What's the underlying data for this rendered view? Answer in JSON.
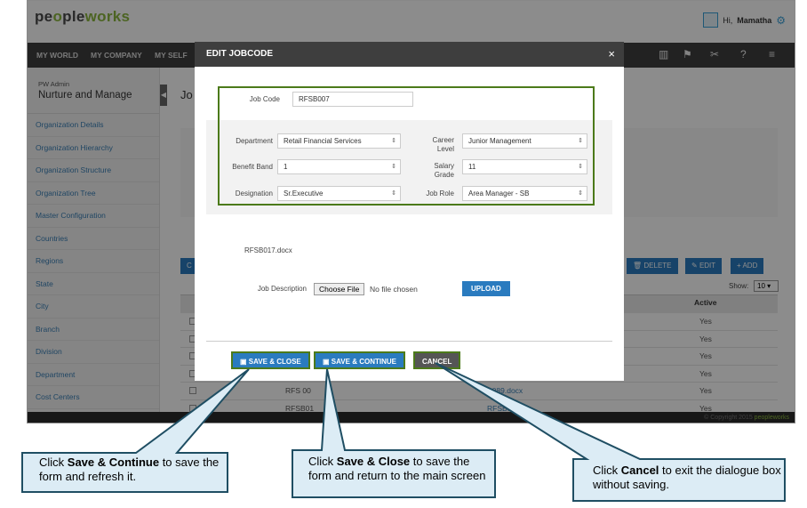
{
  "app": {
    "logo_a": "pe",
    "logo_b": "o",
    "logo_c": "ple",
    "logo_d": "works",
    "greeting": "Hi,",
    "user_name": "Mamatha"
  },
  "nav": {
    "items": [
      "MY WORLD",
      "MY COMPANY",
      "MY SELF"
    ],
    "icons": [
      "book-icon",
      "flag-icon",
      "tools-icon",
      "help-icon",
      "menu-icon"
    ]
  },
  "sidebar": {
    "subtitle": "PW Admin",
    "title": "Nurture and Manage",
    "items": [
      "Organization Details",
      "Organization Hierarchy",
      "Organization Structure",
      "Organization Tree",
      "Master Configuration",
      "Countries",
      "Regions",
      "State",
      "City",
      "Branch",
      "Division",
      "Department",
      "Cost Centers"
    ]
  },
  "main": {
    "title_partial": "Jo",
    "btn_c": "C",
    "delete_label": "DELETE",
    "edit_label": "EDIT",
    "add_label": "ADD",
    "show_label": "Show:",
    "show_value": "10",
    "col_active": "Active",
    "rows": [
      {
        "code": "",
        "doc": "",
        "active": "Yes"
      },
      {
        "code": "",
        "doc": "",
        "active": "Yes"
      },
      {
        "code": "",
        "doc": "",
        "active": "Yes"
      },
      {
        "code": "",
        "doc": "",
        "active": "Yes"
      },
      {
        "code": "RFS 00",
        "doc": "B089.docx",
        "active": "Yes"
      },
      {
        "code": "RFSB01",
        "doc": "RFSB0",
        "active": "Yes"
      }
    ],
    "copyright": "© Copyright 2015"
  },
  "modal": {
    "title": "EDIT JOBCODE",
    "close": "×",
    "job_code_label": "Job Code",
    "job_code_value": "RFSB007",
    "department_label": "Department",
    "department_value": "Retail Financial Services",
    "career_level_label": "Career Level",
    "career_level_value": "Junior Management",
    "benefit_band_label": "Benefit Band",
    "benefit_band_value": "1",
    "salary_grade_label": "Salary Grade",
    "salary_grade_value": "11",
    "designation_label": "Designation",
    "designation_value": "Sr.Executive",
    "job_role_label": "Job Role",
    "job_role_value": "Area Manager - SB",
    "file_name": "RFSB017.docx",
    "job_desc_label": "Job Description",
    "choose_file": "Choose File",
    "no_file": "No file chosen",
    "upload": "UPLOAD",
    "save_close": "SAVE & CLOSE",
    "save_continue": "SAVE & CONTINUE",
    "cancel": "CANCEL"
  },
  "callouts": {
    "c1_pre": "Click ",
    "c1_bold": "Save & Continue",
    "c1_post": " to save the form and refresh it.",
    "c2_pre": "Click ",
    "c2_bold": "Save & Close",
    "c2_post": " to save the form and return to the main screen",
    "c3_pre": "Click ",
    "c3_bold": "Cancel",
    "c3_post": " to exit the dialogue box without saving."
  },
  "colors": {
    "accent_blue": "#2a7bbf",
    "highlight_green": "#4c7a1a",
    "callout_fill": "#dcecf5",
    "callout_stroke": "#1f4e63"
  }
}
